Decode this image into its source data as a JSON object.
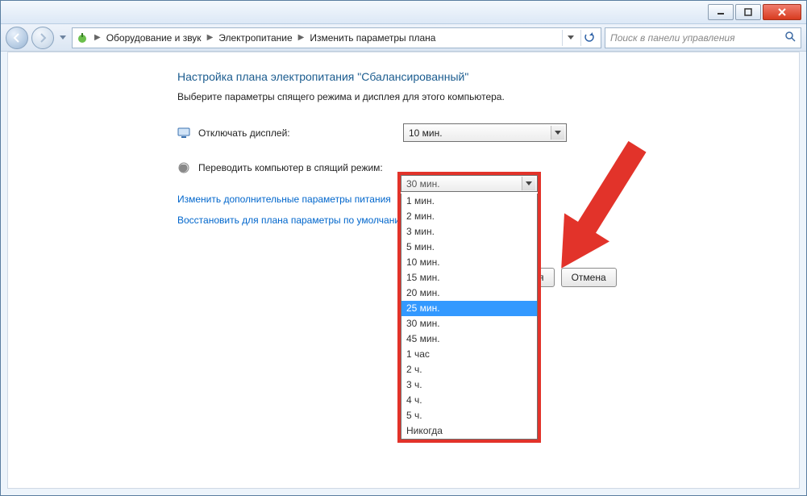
{
  "breadcrumb": {
    "items": [
      "Оборудование и звук",
      "Электропитание",
      "Изменить параметры плана"
    ]
  },
  "search": {
    "placeholder": "Поиск в панели управления"
  },
  "page": {
    "title": "Настройка плана электропитания \"Сбалансированный\"",
    "subtitle": "Выберите параметры спящего режима и дисплея для этого компьютера."
  },
  "settings": {
    "display_off": {
      "label": "Отключать дисплей:",
      "value": "10 мин."
    },
    "sleep": {
      "label": "Переводить компьютер в спящий режим:",
      "value": "30 мин."
    }
  },
  "links": {
    "advanced": "Изменить дополнительные параметры питания",
    "restore": "Восстановить для плана параметры по умолчанию"
  },
  "buttons": {
    "save_partial": "зменения",
    "cancel": "Отмена"
  },
  "dropdown": {
    "options": [
      "1 мин.",
      "2 мин.",
      "3 мин.",
      "5 мин.",
      "10 мин.",
      "15 мин.",
      "20 мин.",
      "25 мин.",
      "30 мин.",
      "45 мин.",
      "1 час",
      "2 ч.",
      "3 ч.",
      "4 ч.",
      "5 ч.",
      "Никогда"
    ],
    "selected_index": 7
  },
  "colors": {
    "annotation_red": "#e2332a",
    "link_blue": "#0066cc",
    "heading_blue": "#1b5c8f",
    "selection_blue": "#3399ff"
  }
}
